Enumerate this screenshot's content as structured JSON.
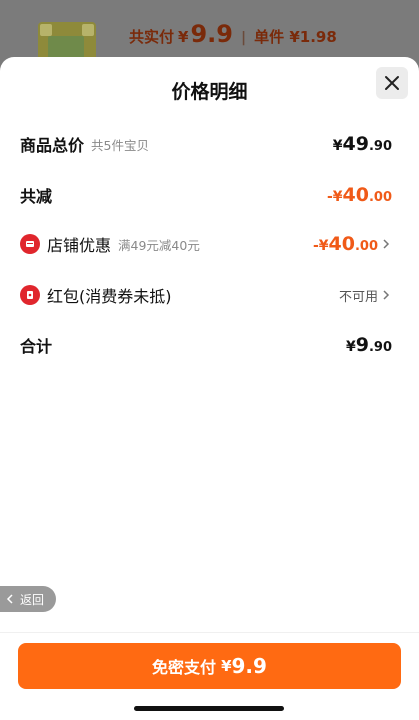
{
  "background": {
    "total_label": "共实付",
    "currency": "¥",
    "total_amount": "9.9",
    "separator": "|",
    "unit_label": "单件 ¥1.98"
  },
  "sheet": {
    "title": "价格明细",
    "rows": {
      "goods": {
        "label": "商品总价",
        "sub": "共5件宝贝",
        "cur": "¥",
        "int": "49",
        "dec": ".90"
      },
      "discount": {
        "label": "共减",
        "cur": "-¥",
        "int": "40",
        "dec": ".00"
      },
      "shop": {
        "label": "店铺优惠",
        "sub": "满49元减40元",
        "cur": "-¥",
        "int": "40",
        "dec": ".00"
      },
      "redpacket": {
        "label": "红包(消费券未抵)",
        "status": "不可用"
      },
      "total": {
        "label": "合计",
        "cur": "¥",
        "int": "9",
        "dec": ".90"
      }
    }
  },
  "back": {
    "label": "返回"
  },
  "pay_button": {
    "label": "免密支付",
    "cur": "¥",
    "amount": "9.9"
  },
  "colors": {
    "accent": "#ff6a12",
    "discount": "#f05a18",
    "icon_red": "#e0262d"
  }
}
